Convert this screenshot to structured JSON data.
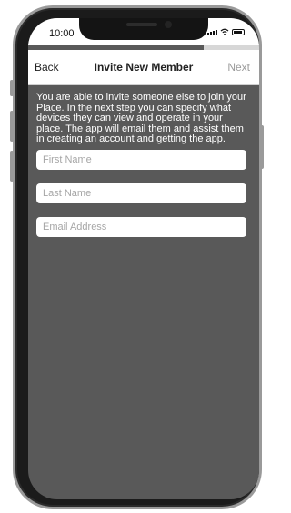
{
  "status_bar": {
    "time": "10:00",
    "icons": [
      "signal-icon",
      "wifi-icon",
      "battery-icon"
    ]
  },
  "progress": {
    "fraction": 0.76
  },
  "nav": {
    "back_label": "Back",
    "title": "Invite New Member",
    "next_label": "Next"
  },
  "description": "You are able to invite someone else to join your Place. In the next step you can specify what devices they can view and operate in your place.  The app will email them and assist them in creating an account and getting the app.",
  "form": {
    "first_name": {
      "value": "",
      "placeholder": "First Name"
    },
    "last_name": {
      "value": "",
      "placeholder": "Last Name"
    },
    "email": {
      "value": "",
      "placeholder": "Email Address"
    }
  },
  "colors": {
    "screen_background": "#595959",
    "nav_background": "#ffffff",
    "next_disabled": "#9b9b9b",
    "progress_track": "#d7d7d7",
    "phone_frame": "#1b1b1b"
  }
}
